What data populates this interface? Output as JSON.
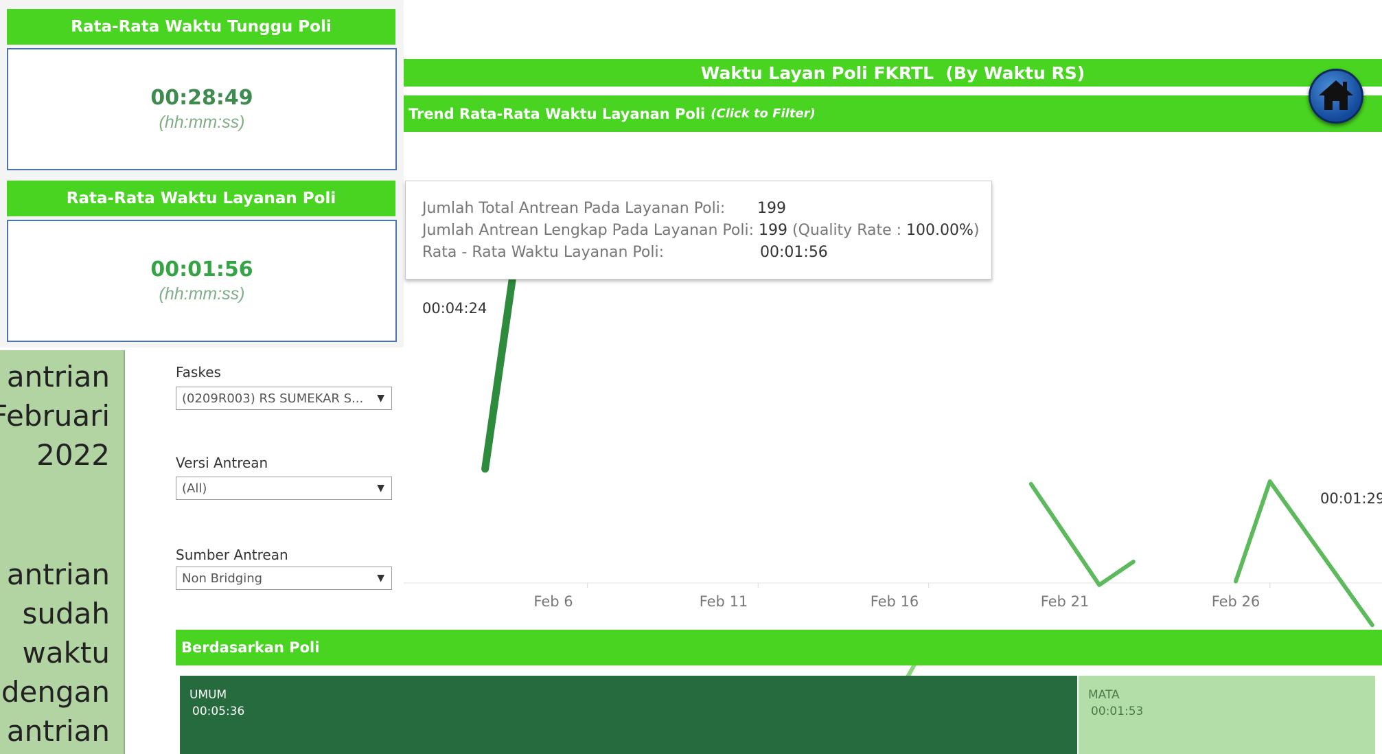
{
  "kpi": [
    {
      "title": "Rata-Rata Waktu Tunggu Poli",
      "value": "00:28:49",
      "unit": "(hh:mm:ss)",
      "color": "#3e8a4f"
    },
    {
      "title": "Rata-Rata Waktu Layanan Poli",
      "value": "00:01:56",
      "unit": "(hh:mm:ss)",
      "color": "#37a347"
    }
  ],
  "left_panel": {
    "lines": [
      "antrian",
      "Februari",
      "2022",
      "antrian",
      "sudah",
      "waktu",
      "dengan",
      "antrian"
    ]
  },
  "filters": [
    {
      "label": "Faskes",
      "value": "(0209R003) RS SUMEKAR S..."
    },
    {
      "label": "Versi Antrean",
      "value": "(All)"
    },
    {
      "label": "Sumber Antrean",
      "value": "Non Bridging"
    }
  ],
  "dashboard": {
    "title": "Waktu Layan Poli FKRTL  (By Waktu RS)",
    "home_icon": "home-icon"
  },
  "trend": {
    "title": "Trend Rata-Rata Waktu Layanan Poli",
    "title_hint": "(Click to Filter)"
  },
  "tooltip": {
    "rows": [
      {
        "label": "Jumlah Total Antrean Pada Layanan Poli:",
        "value": "199",
        "extra": ""
      },
      {
        "label": "Jumlah Antrean Lengkap Pada Layanan Poli:",
        "value": "199",
        "extra": " (Quality Rate : ",
        "rate": "100.00%",
        "close": ")"
      },
      {
        "label": "Rata - Rata Waktu Layanan Poli:",
        "value": "00:01:56",
        "extra": ""
      }
    ]
  },
  "chart_data": {
    "type": "line",
    "x_ticks": [
      "Feb 6",
      "Feb 11",
      "Feb 16",
      "Feb 21",
      "Feb 26"
    ],
    "data_labels": [
      {
        "date": "Feb 3",
        "text": "00:04:24"
      },
      {
        "date": "Mar 1",
        "text": "00:01:29"
      }
    ],
    "segments": [
      {
        "points": [
          [
            "Feb 3",
            264
          ],
          [
            "Feb 4",
            530
          ]
        ],
        "color": "#2e8b3e"
      },
      {
        "points": [
          [
            "Feb 15",
            5
          ],
          [
            "Feb 16",
            73
          ],
          [
            "Feb 17",
            80
          ]
        ],
        "color": "#8cd47e"
      },
      {
        "points": [
          [
            "Feb 19",
            247
          ],
          [
            "Feb 21",
            134
          ],
          [
            "Feb 22",
            160
          ]
        ],
        "color": "#5cba5c"
      },
      {
        "points": [
          [
            "Feb 25",
            138
          ],
          [
            "Feb 26",
            250
          ],
          [
            "Mar 1",
            89
          ]
        ],
        "color": "#5cba5c"
      }
    ],
    "grid": false
  },
  "poli": {
    "title": "Berdasarkan Poli",
    "cells": [
      {
        "name": "UMUM",
        "value": "00:05:36",
        "color": "#266b3d",
        "text_color": "#ffffff"
      },
      {
        "name": "MATA",
        "value": "00:01:53",
        "color": "#b4dea8",
        "text_color": "#4a7a4a"
      }
    ]
  }
}
